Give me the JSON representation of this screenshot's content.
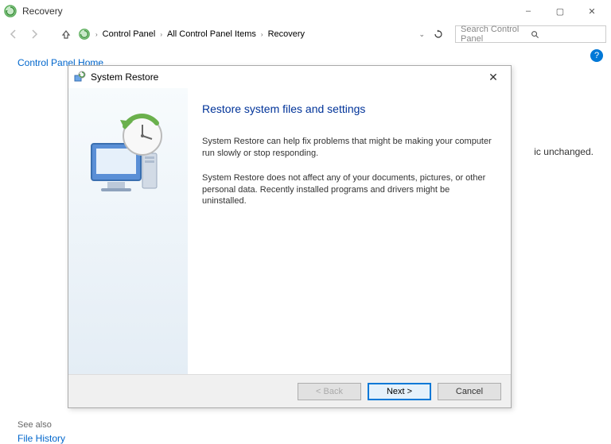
{
  "window": {
    "title": "Recovery",
    "min_label": "–",
    "max_label": "▢",
    "close_label": "✕"
  },
  "nav": {
    "breadcrumb": [
      "Control Panel",
      "All Control Panel Items",
      "Recovery"
    ],
    "search_placeholder": "Search Control Panel"
  },
  "sidebar": {
    "home": "Control Panel Home",
    "see_also": "See also",
    "file_history": "File History"
  },
  "background": {
    "partial_text": "ic unchanged."
  },
  "dialog": {
    "title": "System Restore",
    "heading": "Restore system files and settings",
    "para1": "System Restore can help fix problems that might be making your computer run slowly or stop responding.",
    "para2": "System Restore does not affect any of your documents, pictures, or other personal data. Recently installed programs and drivers might be uninstalled.",
    "back": "< Back",
    "next": "Next >",
    "cancel": "Cancel",
    "close": "✕"
  }
}
